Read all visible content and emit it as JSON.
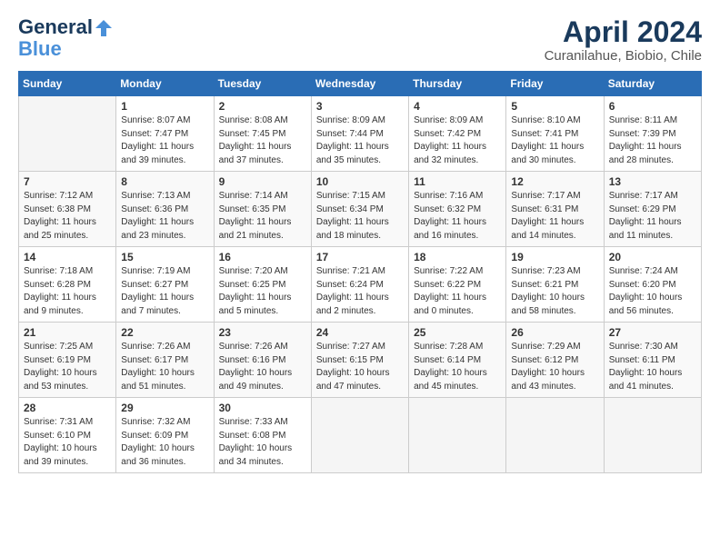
{
  "logo": {
    "line1": "General",
    "line2": "Blue"
  },
  "title": "April 2024",
  "subtitle": "Curanilahue, Biobio, Chile",
  "days_of_week": [
    "Sunday",
    "Monday",
    "Tuesday",
    "Wednesday",
    "Thursday",
    "Friday",
    "Saturday"
  ],
  "weeks": [
    [
      {
        "day": "",
        "empty": true
      },
      {
        "day": "1",
        "sunrise": "8:07 AM",
        "sunset": "7:47 PM",
        "daylight": "11 hours and 39 minutes."
      },
      {
        "day": "2",
        "sunrise": "8:08 AM",
        "sunset": "7:45 PM",
        "daylight": "11 hours and 37 minutes."
      },
      {
        "day": "3",
        "sunrise": "8:09 AM",
        "sunset": "7:44 PM",
        "daylight": "11 hours and 35 minutes."
      },
      {
        "day": "4",
        "sunrise": "8:09 AM",
        "sunset": "7:42 PM",
        "daylight": "11 hours and 32 minutes."
      },
      {
        "day": "5",
        "sunrise": "8:10 AM",
        "sunset": "7:41 PM",
        "daylight": "11 hours and 30 minutes."
      },
      {
        "day": "6",
        "sunrise": "8:11 AM",
        "sunset": "7:39 PM",
        "daylight": "11 hours and 28 minutes."
      }
    ],
    [
      {
        "day": "7",
        "sunrise": "7:12 AM",
        "sunset": "6:38 PM",
        "daylight": "11 hours and 25 minutes."
      },
      {
        "day": "8",
        "sunrise": "7:13 AM",
        "sunset": "6:36 PM",
        "daylight": "11 hours and 23 minutes."
      },
      {
        "day": "9",
        "sunrise": "7:14 AM",
        "sunset": "6:35 PM",
        "daylight": "11 hours and 21 minutes."
      },
      {
        "day": "10",
        "sunrise": "7:15 AM",
        "sunset": "6:34 PM",
        "daylight": "11 hours and 18 minutes."
      },
      {
        "day": "11",
        "sunrise": "7:16 AM",
        "sunset": "6:32 PM",
        "daylight": "11 hours and 16 minutes."
      },
      {
        "day": "12",
        "sunrise": "7:17 AM",
        "sunset": "6:31 PM",
        "daylight": "11 hours and 14 minutes."
      },
      {
        "day": "13",
        "sunrise": "7:17 AM",
        "sunset": "6:29 PM",
        "daylight": "11 hours and 11 minutes."
      }
    ],
    [
      {
        "day": "14",
        "sunrise": "7:18 AM",
        "sunset": "6:28 PM",
        "daylight": "11 hours and 9 minutes."
      },
      {
        "day": "15",
        "sunrise": "7:19 AM",
        "sunset": "6:27 PM",
        "daylight": "11 hours and 7 minutes."
      },
      {
        "day": "16",
        "sunrise": "7:20 AM",
        "sunset": "6:25 PM",
        "daylight": "11 hours and 5 minutes."
      },
      {
        "day": "17",
        "sunrise": "7:21 AM",
        "sunset": "6:24 PM",
        "daylight": "11 hours and 2 minutes."
      },
      {
        "day": "18",
        "sunrise": "7:22 AM",
        "sunset": "6:22 PM",
        "daylight": "11 hours and 0 minutes."
      },
      {
        "day": "19",
        "sunrise": "7:23 AM",
        "sunset": "6:21 PM",
        "daylight": "10 hours and 58 minutes."
      },
      {
        "day": "20",
        "sunrise": "7:24 AM",
        "sunset": "6:20 PM",
        "daylight": "10 hours and 56 minutes."
      }
    ],
    [
      {
        "day": "21",
        "sunrise": "7:25 AM",
        "sunset": "6:19 PM",
        "daylight": "10 hours and 53 minutes."
      },
      {
        "day": "22",
        "sunrise": "7:26 AM",
        "sunset": "6:17 PM",
        "daylight": "10 hours and 51 minutes."
      },
      {
        "day": "23",
        "sunrise": "7:26 AM",
        "sunset": "6:16 PM",
        "daylight": "10 hours and 49 minutes."
      },
      {
        "day": "24",
        "sunrise": "7:27 AM",
        "sunset": "6:15 PM",
        "daylight": "10 hours and 47 minutes."
      },
      {
        "day": "25",
        "sunrise": "7:28 AM",
        "sunset": "6:14 PM",
        "daylight": "10 hours and 45 minutes."
      },
      {
        "day": "26",
        "sunrise": "7:29 AM",
        "sunset": "6:12 PM",
        "daylight": "10 hours and 43 minutes."
      },
      {
        "day": "27",
        "sunrise": "7:30 AM",
        "sunset": "6:11 PM",
        "daylight": "10 hours and 41 minutes."
      }
    ],
    [
      {
        "day": "28",
        "sunrise": "7:31 AM",
        "sunset": "6:10 PM",
        "daylight": "10 hours and 39 minutes."
      },
      {
        "day": "29",
        "sunrise": "7:32 AM",
        "sunset": "6:09 PM",
        "daylight": "10 hours and 36 minutes."
      },
      {
        "day": "30",
        "sunrise": "7:33 AM",
        "sunset": "6:08 PM",
        "daylight": "10 hours and 34 minutes."
      },
      {
        "day": "",
        "empty": true
      },
      {
        "day": "",
        "empty": true
      },
      {
        "day": "",
        "empty": true
      },
      {
        "day": "",
        "empty": true
      }
    ]
  ]
}
